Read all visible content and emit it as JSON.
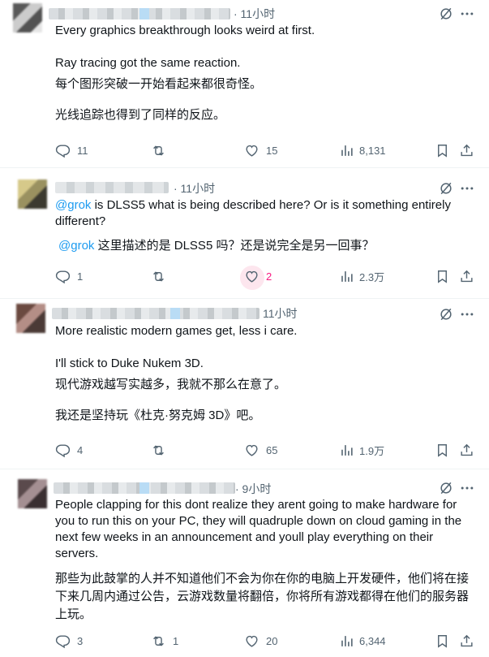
{
  "tweets": [
    {
      "time": "· 11小时",
      "lines": [
        "Every graphics breakthrough looks weird at first.",
        "Ray tracing got the same reaction.",
        "每个图形突破一开始看起来都很奇怪。",
        "光线追踪也得到了同样的反应。"
      ],
      "replies": "11",
      "retweets": "",
      "likes": "15",
      "views": "8,131"
    },
    {
      "time": "· 11小时",
      "mention": "@grok",
      "line1_rest": " is DLSS5 what is being described here? Or is it something entirely different?",
      "translation_mention": "@grok",
      "translation_rest": " 这里描述的是 DLSS5 吗？还是说完全是另一回事？",
      "replies": "1",
      "retweets": "",
      "likes": "2",
      "views": "2.3万"
    },
    {
      "time": "11小时",
      "lines": [
        "More realistic modern games get, less i care.",
        "I'll stick to Duke Nukem 3D.",
        "现代游戏越写实越多，我就不那么在意了。",
        "我还是坚持玩《杜克·努克姆 3D》吧。"
      ],
      "replies": "4",
      "retweets": "",
      "likes": "65",
      "views": "1.9万"
    },
    {
      "time": "· 9小时",
      "lines": [
        "People clapping for this dont realize they arent going to make hardware for you to run this on your PC, they will quadruple down on cloud gaming in the next few weeks in an announcement and youll play everything on their servers.",
        "那些为此鼓掌的人并不知道他们不会为你在你的电脑上开发硬件，他们将在接下来几周内通过公告，云游戏数量将翻倍，你将所有游戏都得在他们的服务器上玩。"
      ],
      "replies": "3",
      "retweets": "1",
      "likes": "20",
      "views": "6,344"
    }
  ],
  "colors": {
    "text": "#0f1419",
    "muted": "#536471",
    "link": "#1d9bf0",
    "like_active": "#f91880"
  },
  "icons": [
    "grok-icon",
    "more-icon",
    "reply-icon",
    "retweet-icon",
    "like-icon",
    "views-icon",
    "bookmark-icon",
    "share-icon"
  ]
}
